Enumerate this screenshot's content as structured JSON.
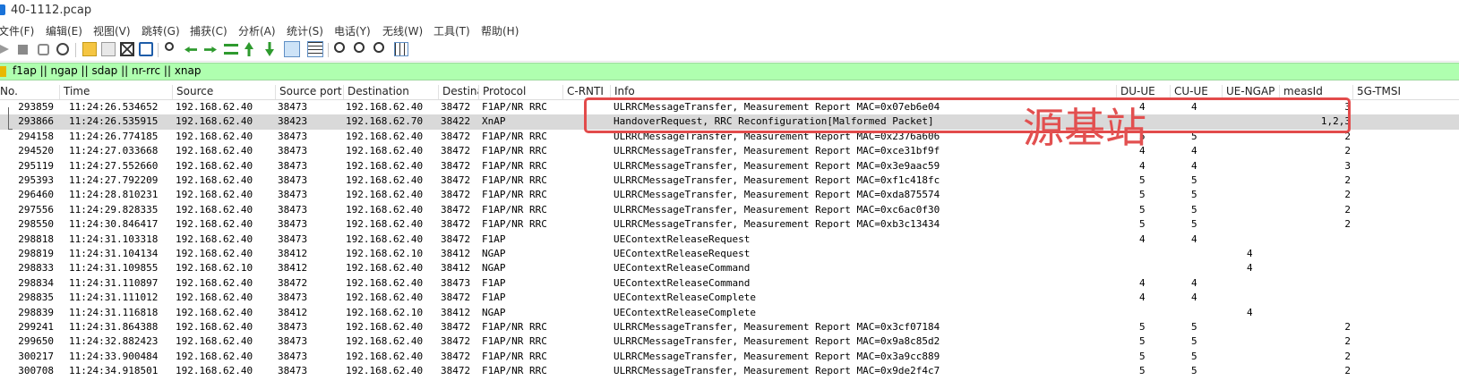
{
  "window": {
    "title": "40-1112.pcap"
  },
  "menu": [
    "文件(F)",
    "编辑(E)",
    "视图(V)",
    "跳转(G)",
    "捕获(C)",
    "分析(A)",
    "统计(S)",
    "电话(Y)",
    "无线(W)",
    "工具(T)",
    "帮助(H)"
  ],
  "toolbar_icons": [
    "start-capture-icon",
    "stop-capture-icon",
    "restart-capture-icon",
    "capture-options-icon",
    "open-file-icon",
    "save-file-icon",
    "close-file-icon",
    "reload-file-icon",
    "find-packet-icon",
    "go-back-icon",
    "go-forward-icon",
    "go-to-packet-icon",
    "first-packet-icon",
    "last-packet-icon",
    "auto-scroll-icon",
    "colorize-icon",
    "zoom-in-icon",
    "zoom-out-icon",
    "normal-size-icon",
    "resize-columns-icon"
  ],
  "filter": {
    "value": "f1ap || ngap || sdap || nr-rrc || xnap",
    "color": "#afffaf"
  },
  "columns": [
    "No.",
    "Time",
    "Source",
    "Source port",
    "Destination",
    "Destina",
    "Protocol",
    "C-RNTI",
    "Info",
    "DU-UE",
    "CU-UE",
    "UE-NGAP",
    "measId",
    "5G-TMSI"
  ],
  "rows": [
    [
      "293859",
      "11:24:26.534652",
      "192.168.62.40",
      "38473",
      "192.168.62.40",
      "38472",
      "F1AP/NR RRC",
      "",
      "ULRRCMessageTransfer, Measurement Report MAC=0x07eb6e04",
      "4",
      "4",
      "",
      "3"
    ],
    [
      "293866",
      "11:24:26.535915",
      "192.168.62.40",
      "38423",
      "192.168.62.70",
      "38422",
      "XnAP",
      "",
      "HandoverRequest, RRC Reconfiguration[Malformed Packet]",
      "",
      "",
      "",
      "1,2,3"
    ],
    [
      "294158",
      "11:24:26.774185",
      "192.168.62.40",
      "38473",
      "192.168.62.40",
      "38472",
      "F1AP/NR RRC",
      "",
      "ULRRCMessageTransfer, Measurement Report MAC=0x2376a606",
      "5",
      "5",
      "",
      "2"
    ],
    [
      "294520",
      "11:24:27.033668",
      "192.168.62.40",
      "38473",
      "192.168.62.40",
      "38472",
      "F1AP/NR RRC",
      "",
      "ULRRCMessageTransfer, Measurement Report MAC=0xce31bf9f",
      "4",
      "4",
      "",
      "2"
    ],
    [
      "295119",
      "11:24:27.552660",
      "192.168.62.40",
      "38473",
      "192.168.62.40",
      "38472",
      "F1AP/NR RRC",
      "",
      "ULRRCMessageTransfer, Measurement Report MAC=0x3e9aac59",
      "4",
      "4",
      "",
      "3"
    ],
    [
      "295393",
      "11:24:27.792209",
      "192.168.62.40",
      "38473",
      "192.168.62.40",
      "38472",
      "F1AP/NR RRC",
      "",
      "ULRRCMessageTransfer, Measurement Report MAC=0xf1c418fc",
      "5",
      "5",
      "",
      "2"
    ],
    [
      "296460",
      "11:24:28.810231",
      "192.168.62.40",
      "38473",
      "192.168.62.40",
      "38472",
      "F1AP/NR RRC",
      "",
      "ULRRCMessageTransfer, Measurement Report MAC=0xda875574",
      "5",
      "5",
      "",
      "2"
    ],
    [
      "297556",
      "11:24:29.828335",
      "192.168.62.40",
      "38473",
      "192.168.62.40",
      "38472",
      "F1AP/NR RRC",
      "",
      "ULRRCMessageTransfer, Measurement Report MAC=0xc6ac0f30",
      "5",
      "5",
      "",
      "2"
    ],
    [
      "298550",
      "11:24:30.846417",
      "192.168.62.40",
      "38473",
      "192.168.62.40",
      "38472",
      "F1AP/NR RRC",
      "",
      "ULRRCMessageTransfer, Measurement Report MAC=0xb3c13434",
      "5",
      "5",
      "",
      "2"
    ],
    [
      "298818",
      "11:24:31.103318",
      "192.168.62.40",
      "38473",
      "192.168.62.40",
      "38472",
      "F1AP",
      "",
      "UEContextReleaseRequest",
      "4",
      "4",
      "",
      ""
    ],
    [
      "298819",
      "11:24:31.104134",
      "192.168.62.40",
      "38412",
      "192.168.62.10",
      "38412",
      "NGAP",
      "",
      "UEContextReleaseRequest",
      "",
      "",
      "4",
      ""
    ],
    [
      "298833",
      "11:24:31.109855",
      "192.168.62.10",
      "38412",
      "192.168.62.40",
      "38412",
      "NGAP",
      "",
      "UEContextReleaseCommand",
      "",
      "",
      "4",
      ""
    ],
    [
      "298834",
      "11:24:31.110897",
      "192.168.62.40",
      "38472",
      "192.168.62.40",
      "38473",
      "F1AP",
      "",
      "UEContextReleaseCommand",
      "4",
      "4",
      "",
      ""
    ],
    [
      "298835",
      "11:24:31.111012",
      "192.168.62.40",
      "38473",
      "192.168.62.40",
      "38472",
      "F1AP",
      "",
      "UEContextReleaseComplete",
      "4",
      "4",
      "",
      ""
    ],
    [
      "298839",
      "11:24:31.116818",
      "192.168.62.40",
      "38412",
      "192.168.62.10",
      "38412",
      "NGAP",
      "",
      "UEContextReleaseComplete",
      "",
      "",
      "4",
      ""
    ],
    [
      "299241",
      "11:24:31.864388",
      "192.168.62.40",
      "38473",
      "192.168.62.40",
      "38472",
      "F1AP/NR RRC",
      "",
      "ULRRCMessageTransfer, Measurement Report MAC=0x3cf07184",
      "5",
      "5",
      "",
      "2"
    ],
    [
      "299650",
      "11:24:32.882423",
      "192.168.62.40",
      "38473",
      "192.168.62.40",
      "38472",
      "F1AP/NR RRC",
      "",
      "ULRRCMessageTransfer, Measurement Report MAC=0x9a8c85d2",
      "5",
      "5",
      "",
      "2"
    ],
    [
      "300217",
      "11:24:33.900484",
      "192.168.62.40",
      "38473",
      "192.168.62.40",
      "38472",
      "F1AP/NR RRC",
      "",
      "ULRRCMessageTransfer, Measurement Report MAC=0x3a9cc889",
      "5",
      "5",
      "",
      "2"
    ],
    [
      "300708",
      "11:24:34.918501",
      "192.168.62.40",
      "38473",
      "192.168.62.40",
      "38472",
      "F1AP/NR RRC",
      "",
      "ULRRCMessageTransfer, Measurement Report MAC=0x9de2f4c7",
      "5",
      "5",
      "",
      "2"
    ]
  ],
  "selected_row": 1,
  "annotation": {
    "label": "源基站",
    "color": "#e24b4b"
  }
}
